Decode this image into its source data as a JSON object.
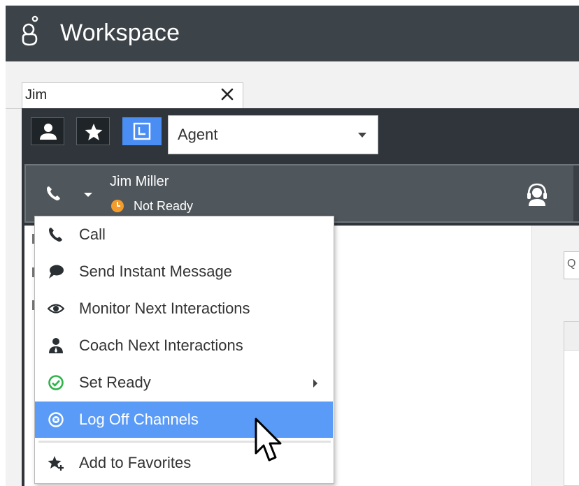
{
  "header": {
    "title": "Workspace",
    "logo_icon": "genesys-logo-icon"
  },
  "search": {
    "value": "Jim",
    "clear_icon": "close-icon"
  },
  "filters": {
    "contacts_icon": "person-icon",
    "favorites_icon": "star-icon",
    "recent_icon": "recent-calendar-icon",
    "type_selected": "Agent"
  },
  "contact": {
    "name": "Jim Miller",
    "status": "Not Ready",
    "status_color": "#f39c2c"
  },
  "right_panel": {
    "input_partial": "Q"
  },
  "menu": {
    "items": [
      {
        "label": "Call",
        "icon": "phone-icon"
      },
      {
        "label": "Send Instant Message",
        "icon": "chat-bubble-icon"
      },
      {
        "label": "Monitor Next Interactions",
        "icon": "eye-icon"
      },
      {
        "label": "Coach Next Interactions",
        "icon": "coach-person-icon"
      },
      {
        "label": "Set Ready",
        "icon": "check-circle-icon",
        "has_submenu": true
      },
      {
        "label": "Log Off Channels",
        "icon": "x-circle-icon",
        "highlighted": true
      },
      {
        "label": "Add to Favorites",
        "icon": "star-add-icon"
      }
    ]
  },
  "colors": {
    "header_bg": "#3d4449",
    "panel_bg": "#2f353a",
    "accent_blue": "#4a8ef3",
    "menu_highlight": "#5b9bf8",
    "ready_green": "#2fb34a"
  }
}
